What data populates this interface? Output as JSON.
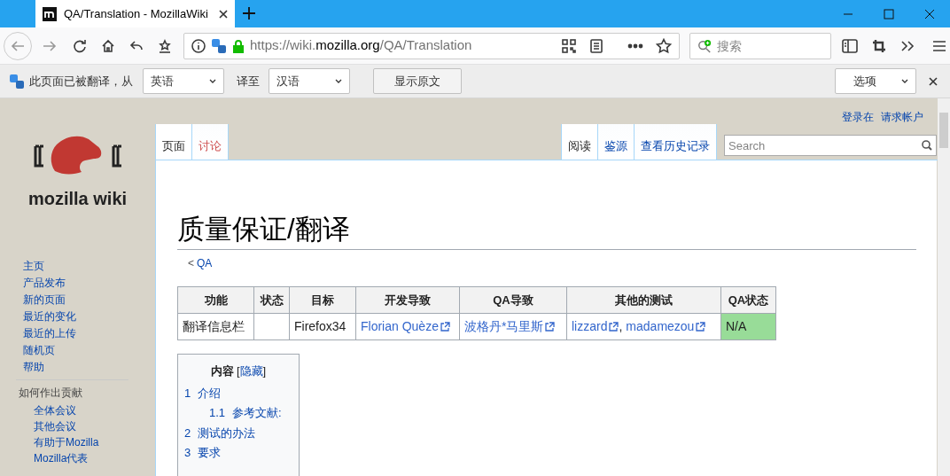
{
  "browser": {
    "tab_title": "QA/Translation - MozillaWiki",
    "url_parts": [
      {
        "text": "https://wiki.",
        "strong": false
      },
      {
        "text": "mozilla.org",
        "strong": true
      },
      {
        "text": "/QA/Translation",
        "strong": false
      }
    ],
    "search_placeholder": "搜索"
  },
  "translation_bar": {
    "message": "此页面已被翻译，从",
    "from_language": "英语",
    "to_label": "译至",
    "to_language": "汉语",
    "show_original": "显示原文",
    "options": "选项"
  },
  "personal_links": [
    "登录在",
    "请求帐户"
  ],
  "logo_text": "mozilla wiki",
  "page_tabs": [
    {
      "label": "页面",
      "selected": true,
      "missing": false
    },
    {
      "label": "讨论",
      "selected": false,
      "missing": true
    }
  ],
  "view_tabs": [
    {
      "label": "阅读",
      "selected": true
    },
    {
      "label": "鉴源",
      "selected": false
    },
    {
      "label": "查看历史记录",
      "selected": false
    }
  ],
  "wiki_search": {
    "placeholder": "Search"
  },
  "sidebar": {
    "items": [
      "主页",
      "产品发布",
      "新的页面",
      "最近的变化",
      "最近的上传",
      "随机页",
      "帮助"
    ],
    "section": {
      "heading": "如何作出贡献",
      "items": [
        "全体会议",
        "其他会议",
        "有助于Mozilla",
        "Mozilla代表"
      ]
    }
  },
  "title": "质量保证/翻译",
  "breadcrumb": {
    "prefix": "<",
    "link": "QA"
  },
  "table": {
    "columns": [
      "功能",
      "状态",
      "目标",
      "开发导致",
      "QA导致",
      "其他的测试",
      "QA状态"
    ],
    "rows": [
      [
        {
          "kind": "text",
          "text": "翻译信息栏"
        },
        {
          "kind": "text",
          "text": ""
        },
        {
          "kind": "text",
          "text": "Firefox34"
        },
        {
          "kind": "links",
          "links": [
            "Florian Quèze"
          ]
        },
        {
          "kind": "links",
          "links": [
            "波格丹*马里斯"
          ]
        },
        {
          "kind": "links",
          "links": [
            "lizzard",
            "madamezou"
          ],
          "separator": ","
        },
        {
          "kind": "text",
          "text": "N/A",
          "color": "#98dc98"
        }
      ]
    ]
  },
  "toc": {
    "title": "内容",
    "toggle_open": "[",
    "toggle": "隐藏",
    "toggle_close": "]",
    "items": [
      {
        "number": "1",
        "label": "介绍",
        "children": [
          {
            "number": "1.1",
            "label": "参考文献:"
          }
        ]
      },
      {
        "number": "2",
        "label": "测试的办法"
      },
      {
        "number": "3",
        "label": "要求"
      }
    ]
  }
}
